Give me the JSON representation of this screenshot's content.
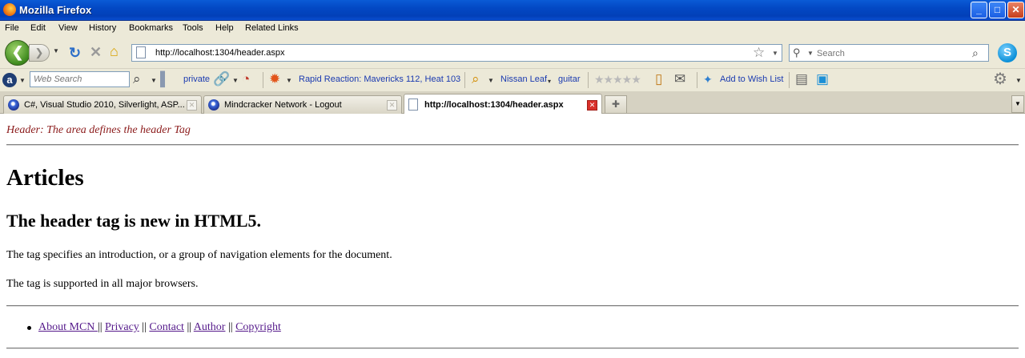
{
  "window": {
    "title": "Mozilla Firefox",
    "min": "_",
    "max": "□",
    "close": "✕"
  },
  "menu": [
    "File",
    "Edit",
    "View",
    "History",
    "Bookmarks",
    "Tools",
    "Help",
    "Related Links"
  ],
  "nav": {
    "url": "http://localhost:1304/header.aspx",
    "search_placeholder": "Search"
  },
  "toolbar": {
    "web_search_placeholder": "Web Search",
    "private": "private",
    "rapid_reaction": "Rapid Reaction: Mavericks 112, Heat 103",
    "nissan_leaf": "Nissan Leaf",
    "guitar": "guitar",
    "wish_list": "Add to Wish List"
  },
  "tabs": [
    {
      "label": "C#, Visual Studio 2010, Silverlight, ASP...",
      "active": false
    },
    {
      "label": "Mindcracker Network - Logout",
      "active": false
    },
    {
      "label": "http://localhost:1304/header.aspx",
      "active": true
    }
  ],
  "page": {
    "header_text": "Header: The area defines the header Tag",
    "title": "Articles",
    "subtitle": "The header tag is new in HTML5.",
    "para1": "The tag specifies an introduction, or a group of navigation elements for the document.",
    "para2": "The tag is supported in all major browsers.",
    "footer_links": [
      "About MCN ",
      "Privacy",
      "Contact",
      "Author",
      "Copyright"
    ],
    "footer_separator": "||"
  },
  "colors": {
    "header_text": "#8b1a1a",
    "link_visited": "#551a8b",
    "titlebar": "#0348c4"
  }
}
